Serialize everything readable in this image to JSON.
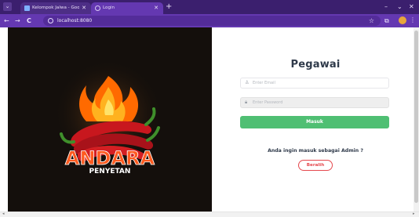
{
  "browser": {
    "tabs": [
      {
        "title": "Kelompok Jalwa - Google Dri…",
        "active": false
      },
      {
        "title": "Login",
        "active": true
      }
    ],
    "new_tab": "+",
    "url": "localhost:8080",
    "controls": {
      "minimize": "–",
      "restore": "⌄",
      "close": "✕"
    },
    "nav": {
      "back": "←",
      "forward": "→",
      "reload": "C"
    },
    "star": "☆",
    "kebab": "⋮",
    "tab_close": "✕",
    "menu": "⌄"
  },
  "brand": {
    "line1": "ANDARA",
    "line2": "PENYETAN",
    "colors": {
      "primary": "#ff5a1f",
      "secondary": "#ffffff",
      "chili": "#c8171e"
    }
  },
  "login_form": {
    "title": "Pegawai",
    "username_placeholder": "Enter Email",
    "password_placeholder": "Enter Password",
    "submit_label": "Masuk",
    "admin_prompt": "Anda ingin masuk sebagai Admin ?",
    "switch_label": "Beralih",
    "username_icon": "user-icon",
    "password_icon": "lock-icon"
  },
  "colors": {
    "accent_green": "#4fbf73",
    "accent_red": "#e5484d",
    "browser_purple": "#6438b1",
    "title_purple": "#3b1f6e"
  }
}
